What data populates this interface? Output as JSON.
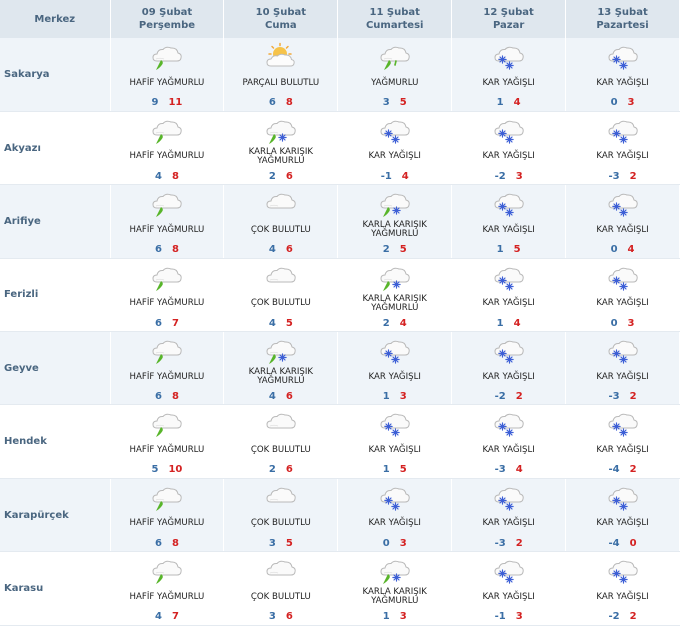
{
  "header": {
    "city_col": "Merkez",
    "days": [
      {
        "date": "09 Şubat",
        "weekday": "Perşembe"
      },
      {
        "date": "10 Şubat",
        "weekday": "Cuma"
      },
      {
        "date": "11 Şubat",
        "weekday": "Cumartesi"
      },
      {
        "date": "12 Şubat",
        "weekday": "Pazar"
      },
      {
        "date": "13 Şubat",
        "weekday": "Pazartesi"
      }
    ]
  },
  "colors": {
    "min": "#3a6ea5",
    "max": "#d42222",
    "header": "#4a6680"
  },
  "rows": [
    {
      "city": "Sakarya",
      "days": [
        {
          "icon": "light-rain-icon",
          "desc": "HAFİF YAĞMURLU",
          "min": "9",
          "max": "11"
        },
        {
          "icon": "partly-cloudy-icon",
          "desc": "PARÇALI BULUTLU",
          "min": "6",
          "max": "8"
        },
        {
          "icon": "rain-icon",
          "desc": "YAĞMURLU",
          "min": "3",
          "max": "5"
        },
        {
          "icon": "snow-icon",
          "desc": "KAR YAĞIŞLI",
          "min": "1",
          "max": "4"
        },
        {
          "icon": "snow-icon",
          "desc": "KAR YAĞIŞLI",
          "min": "0",
          "max": "3"
        }
      ]
    },
    {
      "city": "Akyazı",
      "days": [
        {
          "icon": "light-rain-icon",
          "desc": "HAFİF YAĞMURLU",
          "min": "4",
          "max": "8"
        },
        {
          "icon": "sleet-icon",
          "desc": "KARLA KARIŞIK YAĞMURLU",
          "min": "2",
          "max": "6"
        },
        {
          "icon": "snow-icon",
          "desc": "KAR YAĞIŞLI",
          "min": "-1",
          "max": "4"
        },
        {
          "icon": "snow-icon",
          "desc": "KAR YAĞIŞLI",
          "min": "-2",
          "max": "3"
        },
        {
          "icon": "snow-icon",
          "desc": "KAR YAĞIŞLI",
          "min": "-3",
          "max": "2"
        }
      ]
    },
    {
      "city": "Arifiye",
      "days": [
        {
          "icon": "light-rain-icon",
          "desc": "HAFİF YAĞMURLU",
          "min": "6",
          "max": "8"
        },
        {
          "icon": "cloudy-icon",
          "desc": "ÇOK BULUTLU",
          "min": "4",
          "max": "6"
        },
        {
          "icon": "sleet-icon",
          "desc": "KARLA KARIŞIK YAĞMURLU",
          "min": "2",
          "max": "5"
        },
        {
          "icon": "snow-icon",
          "desc": "KAR YAĞIŞLI",
          "min": "1",
          "max": "5"
        },
        {
          "icon": "snow-icon",
          "desc": "KAR YAĞIŞLI",
          "min": "0",
          "max": "4"
        }
      ]
    },
    {
      "city": "Ferizli",
      "days": [
        {
          "icon": "light-rain-icon",
          "desc": "HAFİF YAĞMURLU",
          "min": "6",
          "max": "7"
        },
        {
          "icon": "cloudy-icon",
          "desc": "ÇOK BULUTLU",
          "min": "4",
          "max": "5"
        },
        {
          "icon": "sleet-icon",
          "desc": "KARLA KARIŞIK YAĞMURLU",
          "min": "2",
          "max": "4"
        },
        {
          "icon": "snow-icon",
          "desc": "KAR YAĞIŞLI",
          "min": "1",
          "max": "4"
        },
        {
          "icon": "snow-icon",
          "desc": "KAR YAĞIŞLI",
          "min": "0",
          "max": "3"
        }
      ]
    },
    {
      "city": "Geyve",
      "days": [
        {
          "icon": "light-rain-icon",
          "desc": "HAFİF YAĞMURLU",
          "min": "6",
          "max": "8"
        },
        {
          "icon": "sleet-icon",
          "desc": "KARLA KARIŞIK YAĞMURLU",
          "min": "4",
          "max": "6"
        },
        {
          "icon": "snow-icon",
          "desc": "KAR YAĞIŞLI",
          "min": "1",
          "max": "3"
        },
        {
          "icon": "snow-icon",
          "desc": "KAR YAĞIŞLI",
          "min": "-2",
          "max": "2"
        },
        {
          "icon": "snow-icon",
          "desc": "KAR YAĞIŞLI",
          "min": "-3",
          "max": "2"
        }
      ]
    },
    {
      "city": "Hendek",
      "days": [
        {
          "icon": "light-rain-icon",
          "desc": "HAFİF YAĞMURLU",
          "min": "5",
          "max": "10"
        },
        {
          "icon": "cloudy-icon",
          "desc": "ÇOK BULUTLU",
          "min": "2",
          "max": "6"
        },
        {
          "icon": "snow-icon",
          "desc": "KAR YAĞIŞLI",
          "min": "1",
          "max": "5"
        },
        {
          "icon": "snow-icon",
          "desc": "KAR YAĞIŞLI",
          "min": "-3",
          "max": "4"
        },
        {
          "icon": "snow-icon",
          "desc": "KAR YAĞIŞLI",
          "min": "-4",
          "max": "2"
        }
      ]
    },
    {
      "city": "Karapürçek",
      "days": [
        {
          "icon": "light-rain-icon",
          "desc": "HAFİF YAĞMURLU",
          "min": "6",
          "max": "8"
        },
        {
          "icon": "cloudy-icon",
          "desc": "ÇOK BULUTLU",
          "min": "3",
          "max": "5"
        },
        {
          "icon": "snow-icon",
          "desc": "KAR YAĞIŞLI",
          "min": "0",
          "max": "3"
        },
        {
          "icon": "snow-icon",
          "desc": "KAR YAĞIŞLI",
          "min": "-3",
          "max": "2"
        },
        {
          "icon": "snow-icon",
          "desc": "KAR YAĞIŞLI",
          "min": "-4",
          "max": "0"
        }
      ]
    },
    {
      "city": "Karasu",
      "days": [
        {
          "icon": "light-rain-icon",
          "desc": "HAFİF YAĞMURLU",
          "min": "4",
          "max": "7"
        },
        {
          "icon": "cloudy-icon",
          "desc": "ÇOK BULUTLU",
          "min": "3",
          "max": "6"
        },
        {
          "icon": "sleet-icon",
          "desc": "KARLA KARIŞIK YAĞMURLU",
          "min": "1",
          "max": "3"
        },
        {
          "icon": "snow-icon",
          "desc": "KAR YAĞIŞLI",
          "min": "-1",
          "max": "3"
        },
        {
          "icon": "snow-icon",
          "desc": "KAR YAĞIŞLI",
          "min": "-2",
          "max": "2"
        }
      ]
    }
  ]
}
